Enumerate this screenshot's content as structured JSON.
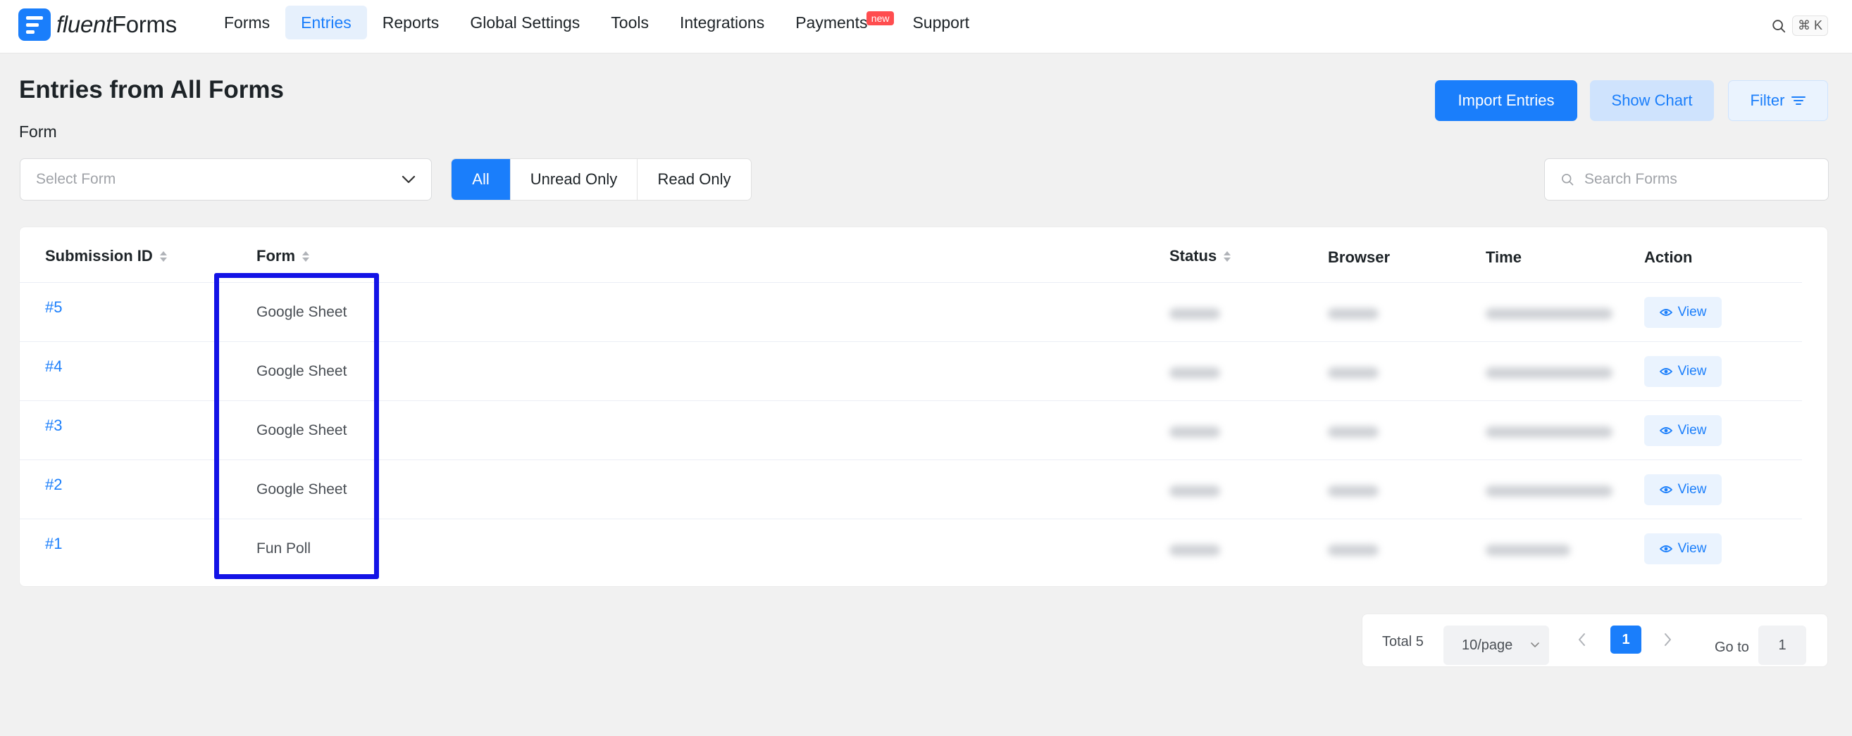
{
  "brand": {
    "name_light": "fluent",
    "name_bold": "Forms"
  },
  "nav": {
    "items": [
      {
        "label": "Forms"
      },
      {
        "label": "Entries"
      },
      {
        "label": "Reports"
      },
      {
        "label": "Global Settings"
      },
      {
        "label": "Tools"
      },
      {
        "label": "Integrations"
      },
      {
        "label": "Payments",
        "badge": "new"
      },
      {
        "label": "Support"
      }
    ],
    "active": "Entries",
    "shortcut": "⌘ K"
  },
  "header": {
    "title": "Entries from All Forms",
    "form_label": "Form",
    "import_label": "Import Entries",
    "chart_label": "Show Chart",
    "filter_label": "Filter"
  },
  "controls": {
    "select_placeholder": "Select Form",
    "segments": [
      {
        "label": "All",
        "selected": true
      },
      {
        "label": "Unread Only",
        "selected": false
      },
      {
        "label": "Read Only",
        "selected": false
      }
    ],
    "search_placeholder": "Search Forms"
  },
  "table": {
    "columns": {
      "id": "Submission ID",
      "form": "Form",
      "status": "Status",
      "browser": "Browser",
      "time": "Time",
      "action": "Action"
    },
    "rows": [
      {
        "id": "#5",
        "form": "Google Sheet",
        "action": "View"
      },
      {
        "id": "#4",
        "form": "Google Sheet",
        "action": "View"
      },
      {
        "id": "#3",
        "form": "Google Sheet",
        "action": "View"
      },
      {
        "id": "#2",
        "form": "Google Sheet",
        "action": "View"
      },
      {
        "id": "#1",
        "form": "Fun Poll",
        "action": "View"
      }
    ]
  },
  "pagination": {
    "total": "Total 5",
    "page_size": "10/page",
    "current_page": "1",
    "goto_label": "Go to",
    "goto_value": "1"
  },
  "colors": {
    "accent": "#1a7efb",
    "highlight": "#1313e6",
    "badge": "#ff4d4f"
  }
}
